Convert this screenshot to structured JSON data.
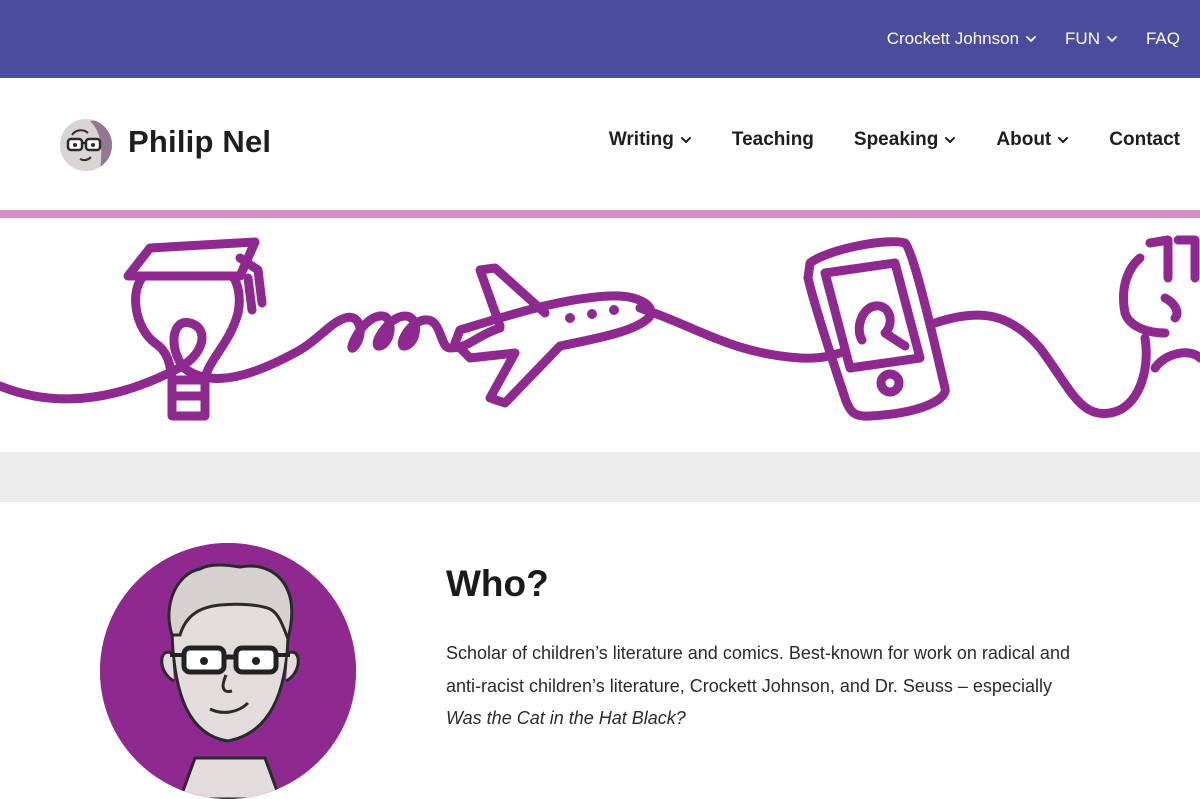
{
  "topbar": {
    "background": "#4b4c9e",
    "items": [
      {
        "label": "Crockett Johnson",
        "has_dropdown": true
      },
      {
        "label": "FUN",
        "has_dropdown": true
      },
      {
        "label": "FAQ",
        "has_dropdown": false
      }
    ]
  },
  "header": {
    "site_title": "Philip Nel",
    "nav": [
      {
        "label": "Writing",
        "has_dropdown": true
      },
      {
        "label": "Teaching",
        "has_dropdown": false
      },
      {
        "label": "Speaking",
        "has_dropdown": true
      },
      {
        "label": "About",
        "has_dropdown": true
      },
      {
        "label": "Contact",
        "has_dropdown": false
      }
    ]
  },
  "banner": {
    "accent": "#8e2a8f",
    "divider_color": "#d48fc9",
    "icons": [
      "graduation-cap-lightbulb-icon",
      "airplane-icon",
      "smartphone-icon",
      "raised-fist-icon"
    ]
  },
  "intro": {
    "heading": "Who?",
    "text_part1": "Scholar of children’s literature and comics. Best-known for work on radical and anti-racist children’s literature, Crockett Johnson, and Dr. Seuss – especially ",
    "text_italic": "Was the Cat in the Hat Black?"
  }
}
